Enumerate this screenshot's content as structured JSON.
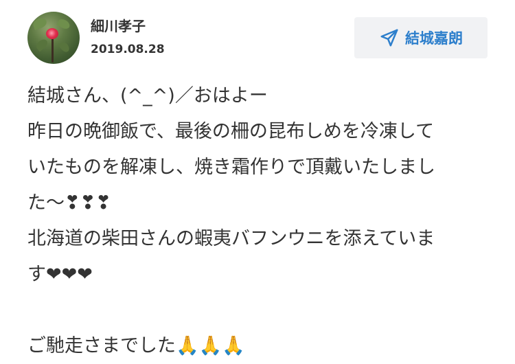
{
  "post": {
    "author": "細川孝子",
    "date": "2019.08.28",
    "recipient": "結城嘉朗",
    "message_lines": [
      "結城さん、(^_^)／おはよー",
      "昨日の晩御飯で、最後の柵の昆布しめを冷凍して",
      "いたものを解凍し、焼き霜作りで頂戴いたしまし",
      "た〜❣❣❣",
      "北海道の柴田さんの蝦夷バフンウニを添えていま",
      "す❤❤❤",
      "",
      "ご馳走さまでした🙏🙏🙏"
    ]
  },
  "icons": {
    "recipient": "send-icon"
  },
  "colors": {
    "accent": "#2d7fcc",
    "text": "#333333",
    "button_bg": "#f1f2f4"
  }
}
